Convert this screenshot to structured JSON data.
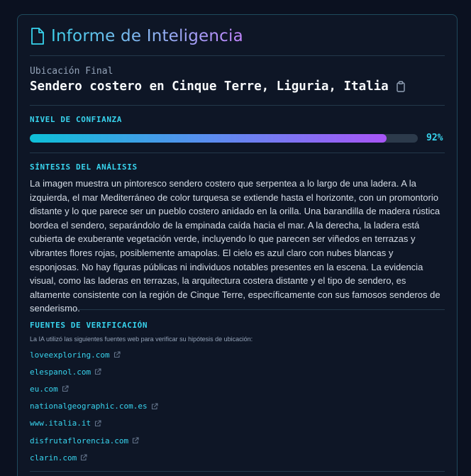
{
  "header": {
    "title": "Informe de Inteligencia",
    "icon": "document-icon"
  },
  "location": {
    "label": "Ubicación Final",
    "value": "Sendero costero en Cinque Terre, Liguria, Italia",
    "copy_icon": "clipboard-icon"
  },
  "confidence": {
    "title": "NIVEL DE CONFIANZA",
    "percent_label": "92%",
    "value": 0.92
  },
  "synthesis": {
    "title": "SÍNTESIS DEL ANÁLISIS",
    "text": "La imagen muestra un pintoresco sendero costero que serpentea a lo largo de una ladera. A la izquierda, el mar Mediterráneo de color turquesa se extiende hasta el horizonte, con un promontorio distante y lo que parece ser un pueblo costero anidado en la orilla. Una barandilla de madera rústica bordea el sendero, separándolo de la empinada caída hacia el mar. A la derecha, la ladera está cubierta de exuberante vegetación verde, incluyendo lo que parecen ser viñedos en terrazas y vibrantes flores rojas, posiblemente amapolas. El cielo es azul claro con nubes blancas y esponjosas. No hay figuras públicas ni individuos notables presentes en la escena. La evidencia visual, como las laderas en terrazas, la arquitectura costera distante y el tipo de sendero, es altamente consistente con la región de Cinque Terre, específicamente con sus famosos senderos de senderismo."
  },
  "sources": {
    "title": "FUENTES DE VERIFICACIÓN",
    "intro": "La IA utilizó las siguientes fuentes web para verificar su hipótesis de ubicación:",
    "link_icon": "external-link-icon",
    "items": [
      "loveexploring.com",
      "elespanol.com",
      "eu.com",
      "nationalgeographic.com.es",
      "www.italia.it",
      "disfrutaflorencia.com",
      "clarin.com"
    ]
  },
  "colors": {
    "accent": "#38d4ee",
    "gradient_start": "#0ec0d8",
    "gradient_end": "#a855f7",
    "background": "#0b1120",
    "panel": "#0e1626"
  }
}
